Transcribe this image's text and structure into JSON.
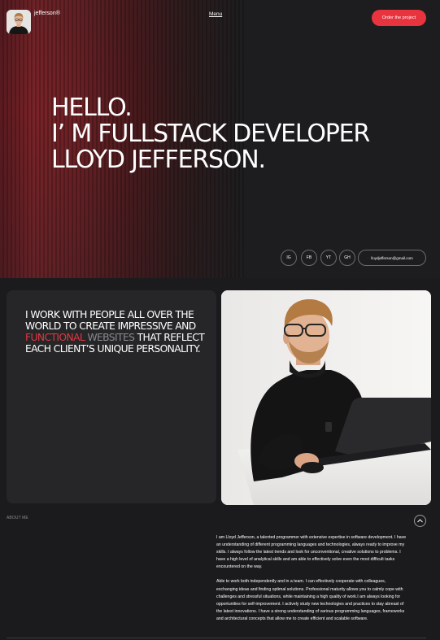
{
  "header": {
    "brand_name": "jefferson®",
    "menu_label": "Menu",
    "order_button": "Order the project"
  },
  "hero": {
    "line1": "HELLO.",
    "line2": "I’ M FULLSTACK DEVELOPER",
    "line3": "LLOYD JEFFERSON."
  },
  "social": [
    {
      "label": "IG"
    },
    {
      "label": "FB"
    },
    {
      "label": "YT"
    },
    {
      "label": "GH"
    }
  ],
  "email": "lloydjefferson@gmail.com",
  "statement": {
    "part1": "I WORK WITH PEOPLE ALL OVER THE WORLD TO CREATE IMPRESSIVE AND ",
    "highlight_red": "FUNCTIONAL",
    "space": " ",
    "highlight_gray": "WEBSITES",
    "part2": " THAT REFLECT EACH CLIENT’S UNIQUE PERSONALITY."
  },
  "about": {
    "label": "ABOUT ME",
    "paragraph1": "I am Lloyd Jefferson, a talented programmer with extensive expertise in software development. I have an understanding of different programming languages and technologies, always ready to improve my skills. I always follow the latest trends and look for unconventional, creative solutions to problems. I have a high level of analytical skills and am able to effectively solve even the most difficult tasks encountered on the way.",
    "paragraph2": "Able to work both independently and in a team. I can effectively cooperate with colleagues, exchanging ideas and finding optimal solutions. Professional maturity allows you to calmly cope with challenges and stressful situations, while maintaining a high quality of work.I am always looking for opportunities for self-improvement. I actively study new technologies and practices to stay abreast of the latest innovations. I have a strong understanding of various programming languages, frameworks and architectural concepts that allow me to create efficient and scalable software."
  },
  "colors": {
    "accent": "#e8343f",
    "background": "#1b1b1d",
    "card": "#262628",
    "muted": "#8a8a8e"
  },
  "icons": {
    "scroll_up": "chevron-up-icon"
  }
}
